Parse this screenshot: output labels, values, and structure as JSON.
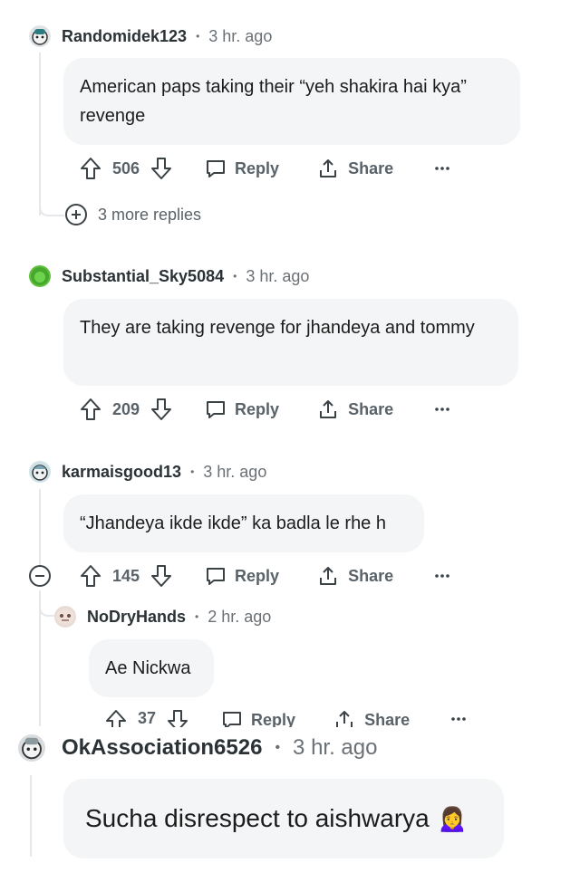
{
  "comments": [
    {
      "username": "Randomidek123",
      "time": "3 hr. ago",
      "text": "American paps taking their “yeh shakira hai kya” revenge",
      "votes": "506",
      "reply": "Reply",
      "share": "Share",
      "more_replies": "3 more replies"
    },
    {
      "username": "Substantial_Sky5084",
      "time": "3 hr. ago",
      "text": "They are taking revenge for jhandeya and tommy",
      "votes": "209",
      "reply": "Reply",
      "share": "Share"
    },
    {
      "username": "karmaisgood13",
      "time": "3 hr. ago",
      "text": "“Jhandeya ikde ikde” ka badla le rhe h",
      "votes": "145",
      "reply": "Reply",
      "share": "Share"
    },
    {
      "username": "NoDryHands",
      "time": "2 hr. ago",
      "text": "Ae Nickwa",
      "votes": "37",
      "reply": "Reply",
      "share": "Share"
    },
    {
      "username": "OkAssociation6526",
      "time": "3 hr. ago",
      "text": "Sucha disrespect to aishwarya",
      "emoji": "🙍‍♀️"
    }
  ],
  "separator": "•",
  "colors": {
    "text_muted": "#596268",
    "bubble": "#f3f5f6",
    "thread": "#e5e7ea"
  }
}
